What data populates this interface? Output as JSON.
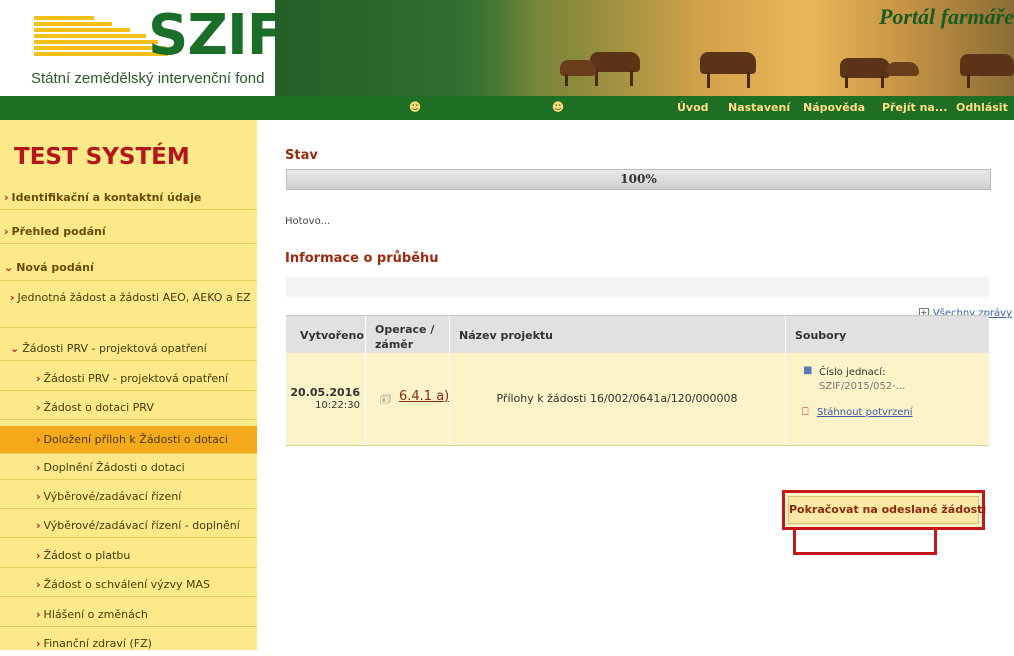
{
  "header": {
    "logo": "SZIF",
    "org_name": "Státní zemědělský intervenční fond",
    "portal_title": "Portál farmáře"
  },
  "nav": {
    "links": [
      "Úvod",
      "Nastavení",
      "Nápověda",
      "Přejít na...",
      "Odhlásit"
    ]
  },
  "sidebar": {
    "title": "TEST SYSTÉM",
    "items": [
      {
        "label": "Identifikační a kontaktní údaje",
        "arrow": ">"
      },
      {
        "label": "Přehled podání",
        "arrow": ">"
      },
      {
        "label": "Nová podání",
        "arrow": "v"
      },
      {
        "label": "Jednotná žádost a žádosti AEO, AEKO a EZ",
        "arrow": ">"
      },
      {
        "label": "Žádosti PRV - projektová opatření",
        "arrow": "v"
      },
      {
        "label": "Žádosti PRV - projektová opatření",
        "arrow": ">"
      },
      {
        "label": "Žádost o dotaci PRV",
        "arrow": ">"
      },
      {
        "label": "Doložení příloh k Žádosti o dotaci",
        "arrow": ">"
      },
      {
        "label": "Doplnění Žádosti o dotaci",
        "arrow": ">"
      },
      {
        "label": "Výběrové/zadávací řízení",
        "arrow": ">"
      },
      {
        "label": "Výběrové/zadávací řízení - doplnění",
        "arrow": ">"
      },
      {
        "label": "Žádost o platbu",
        "arrow": ">"
      },
      {
        "label": "Žádost o schválení výzvy MAS",
        "arrow": ">"
      },
      {
        "label": "Hlášení o změnách",
        "arrow": ">"
      },
      {
        "label": "Finanční zdraví (FZ)",
        "arrow": ">"
      }
    ]
  },
  "main": {
    "status_heading": "Stav",
    "progress_percent": 100,
    "progress_label": "100%",
    "status_text": "Hotovo...",
    "progress_heading": "Informace o průběhu",
    "all_messages": "Všechny zprávy",
    "table": {
      "headers": [
        "Vytvořeno",
        "Operace / záměr",
        "Název projektu",
        "Soubory"
      ],
      "row": {
        "date": "20.05.2016",
        "time": "10:22:30",
        "operation": "6.4.1 a)",
        "project": "Přílohy k žádosti 16/002/0641a/120/000008",
        "file_ref_label": "Číslo jednací:",
        "file_ref_value": "SZIF/2015/052-...",
        "download_label": "Stáhnout potvrzení"
      }
    },
    "continue_button": "Pokračovat na odeslané žádosti"
  },
  "colors": {
    "brand_green": "#1e6e24",
    "sidebar_bg": "#fbe98a",
    "active_item": "#f4aa1a",
    "title_red": "#b3171b",
    "highlight_red": "#c4161c"
  }
}
